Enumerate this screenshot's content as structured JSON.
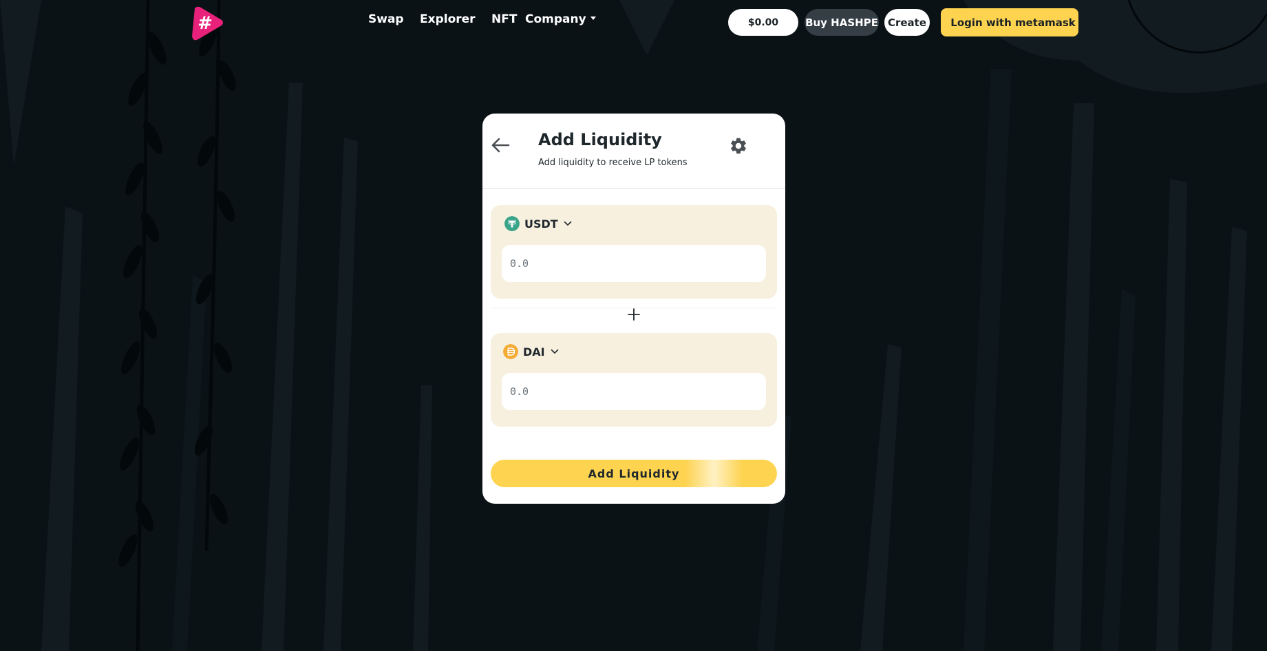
{
  "nav": {
    "links": [
      "Swap",
      "Explorer",
      "NFT",
      "Company"
    ]
  },
  "header": {
    "balance": "$0.00",
    "buy_label": "Buy HASHPE",
    "create_label": "Create",
    "login_label": "Login with metamask"
  },
  "card": {
    "title": "Add Liquidity",
    "subtitle": "Add liquidity to receive LP tokens",
    "token_a": {
      "symbol": "USDT",
      "placeholder": "0.0",
      "icon": "tether-icon"
    },
    "token_b": {
      "symbol": "DAI",
      "placeholder": "0.0",
      "icon": "dai-icon"
    },
    "submit_label": "Add Liquidity"
  },
  "colors": {
    "background": "#0b1216",
    "accent": "#fed350",
    "brand_pink": "#e8217a",
    "panel": "#f8f0df",
    "usdt": "#3aa58a",
    "dai": "#f5ac37"
  }
}
